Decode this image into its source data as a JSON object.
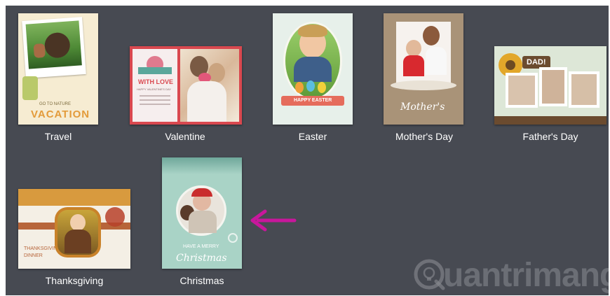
{
  "templates": [
    {
      "name": "Travel",
      "thumb_text": [
        "GO TO NATURE",
        "VACATION"
      ]
    },
    {
      "name": "Valentine",
      "thumb_text": [
        "WITH LOVE",
        "HAPPY VALENTINE'S DAY"
      ]
    },
    {
      "name": "Easter",
      "thumb_text": [
        "HAPPY EASTER"
      ]
    },
    {
      "name": "Mother's Day",
      "thumb_text": [
        "Mother's"
      ]
    },
    {
      "name": "Father's Day",
      "thumb_text": [
        "DAD!"
      ]
    },
    {
      "name": "Thanksgiving",
      "thumb_text": [
        "THANKSGIVING",
        "DINNER"
      ]
    },
    {
      "name": "Christmas",
      "thumb_text": [
        "HAVE A MERRY",
        "Christmas"
      ]
    }
  ],
  "annotation": {
    "arrow_target": "Christmas",
    "color": "#c8179c"
  },
  "watermark": {
    "text": "uantrimang"
  },
  "colors": {
    "panel_bg": "#474a52",
    "label": "#ffffff"
  }
}
